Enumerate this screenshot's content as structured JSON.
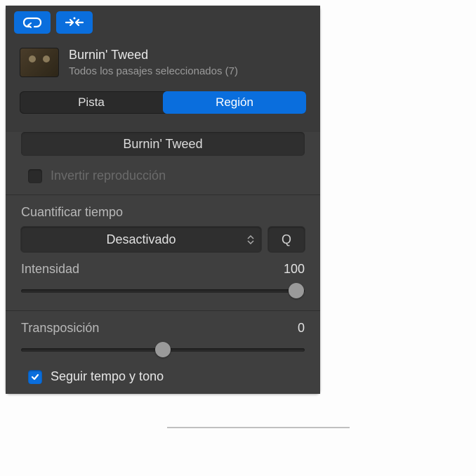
{
  "header": {
    "title": "Burnin' Tweed",
    "subtitle": "Todos los pasajes seleccionados (7)"
  },
  "segmented": {
    "track": "Pista",
    "region": "Región"
  },
  "region_name": "Burnin' Tweed",
  "reverse": {
    "label": "Invertir reproducción",
    "checked": false
  },
  "quantize": {
    "label": "Cuantificar tiempo",
    "value": "Desactivado",
    "q_button": "Q"
  },
  "intensity": {
    "label": "Intensidad",
    "value": "100",
    "percent": 100
  },
  "transpose": {
    "label": "Transposición",
    "value": "0",
    "percent": 50
  },
  "follow": {
    "label": "Seguir tempo y tono",
    "checked": true
  }
}
